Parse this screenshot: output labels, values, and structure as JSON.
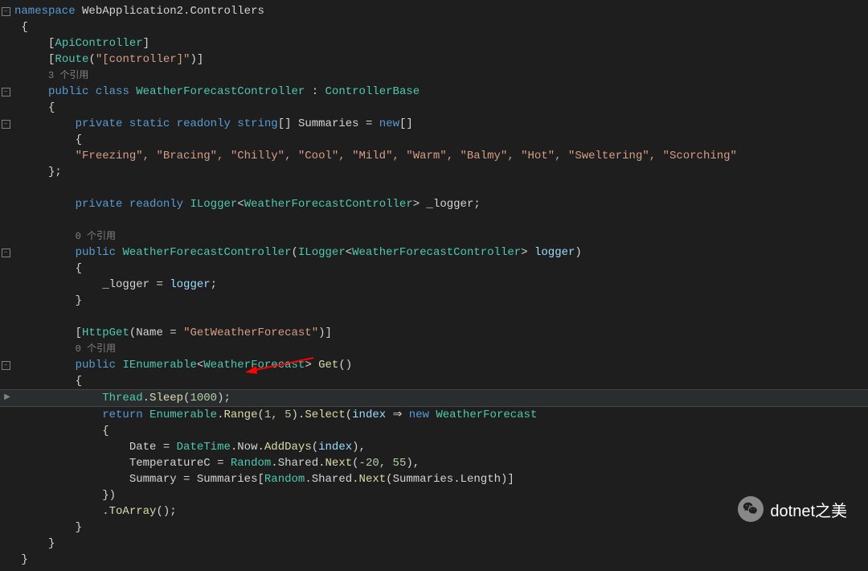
{
  "code": {
    "namespace": "namespace",
    "nsName": "WebApplication2.Controllers",
    "apiController": "ApiController",
    "route": "Route",
    "routeArg": "\"[controller]\"",
    "refs3": "3 个引用",
    "refs0": "0 个引用",
    "publicKw": "public",
    "classKw": "class",
    "className": "WeatherForecastController",
    "controllerBase": "ControllerBase",
    "privateKw": "private",
    "staticKw": "static",
    "readonlyKw": "readonly",
    "stringKw": "string",
    "summariesField": "Summaries",
    "newKw": "new",
    "summariesValues": "\"Freezing\", \"Bracing\", \"Chilly\", \"Cool\", \"Mild\", \"Warm\", \"Balmy\", \"Hot\", \"Sweltering\", \"Scorching\"",
    "iLogger": "ILogger",
    "loggerField": "_logger",
    "loggerParam": "logger",
    "httpGet": "HttpGet",
    "nameProp": "Name",
    "httpGetName": "\"GetWeatherForecast\"",
    "ienumerable": "IEnumerable",
    "weatherForecast": "WeatherForecast",
    "getMethod": "Get",
    "thread": "Thread",
    "sleep": "Sleep",
    "sleepArg": "1000",
    "returnKw": "return",
    "enumerable": "Enumerable",
    "range": "Range",
    "rangeArgs": "1, 5",
    "select": "Select",
    "indexParam": "index",
    "arrow": "⇒",
    "dateProp": "Date",
    "dateTime": "DateTime",
    "now": "Now",
    "addDays": "AddDays",
    "tempProp": "TemperatureC",
    "random": "Random",
    "shared": "Shared",
    "next": "Next",
    "nextArgs1": "-20, 55",
    "summaryProp": "Summary",
    "length": "Length",
    "toArray": "ToArray"
  },
  "watermark": "dotnet之美"
}
